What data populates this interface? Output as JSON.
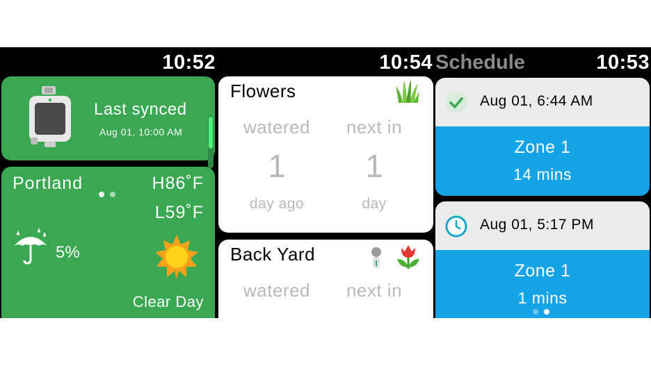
{
  "screens": {
    "status": {
      "time": "10:52"
    },
    "sync": {
      "title": "Last synced",
      "date": "Aug 01, 10:00 AM"
    },
    "weather": {
      "city": "Portland",
      "high": "H86˚F",
      "low": "L59˚F",
      "precip": "5%",
      "condition": "Clear Day"
    },
    "zones_status": {
      "time": "10:54"
    },
    "zones": [
      {
        "name": "Flowers",
        "watered_label": "watered",
        "next_label": "next in",
        "watered_value": "1",
        "watered_unit": "day ago",
        "next_value": "1",
        "next_unit": "day",
        "icon": "grass-icon"
      },
      {
        "name": "Back Yard",
        "watered_label": "watered",
        "next_label": "next in",
        "icon": "tulip-icon"
      }
    ],
    "schedule": {
      "title": "Schedule",
      "time": "10:53",
      "items": [
        {
          "date": "Aug 01, 6:44 AM",
          "zone": "Zone 1",
          "duration": "14 mins",
          "status_icon": "check-icon"
        },
        {
          "date": "Aug 01, 5:17 PM",
          "zone": "Zone 1",
          "duration": "1 mins",
          "status_icon": "clock-icon"
        }
      ]
    }
  },
  "colors": {
    "green": "#3aa853",
    "blue": "#14a3e6",
    "sun": "#f9a11b",
    "check": "#3aa853",
    "clock": "#16a7c9"
  },
  "page_indicator": {
    "screen1_active": 1,
    "screen3_active": 2,
    "total": 2
  }
}
